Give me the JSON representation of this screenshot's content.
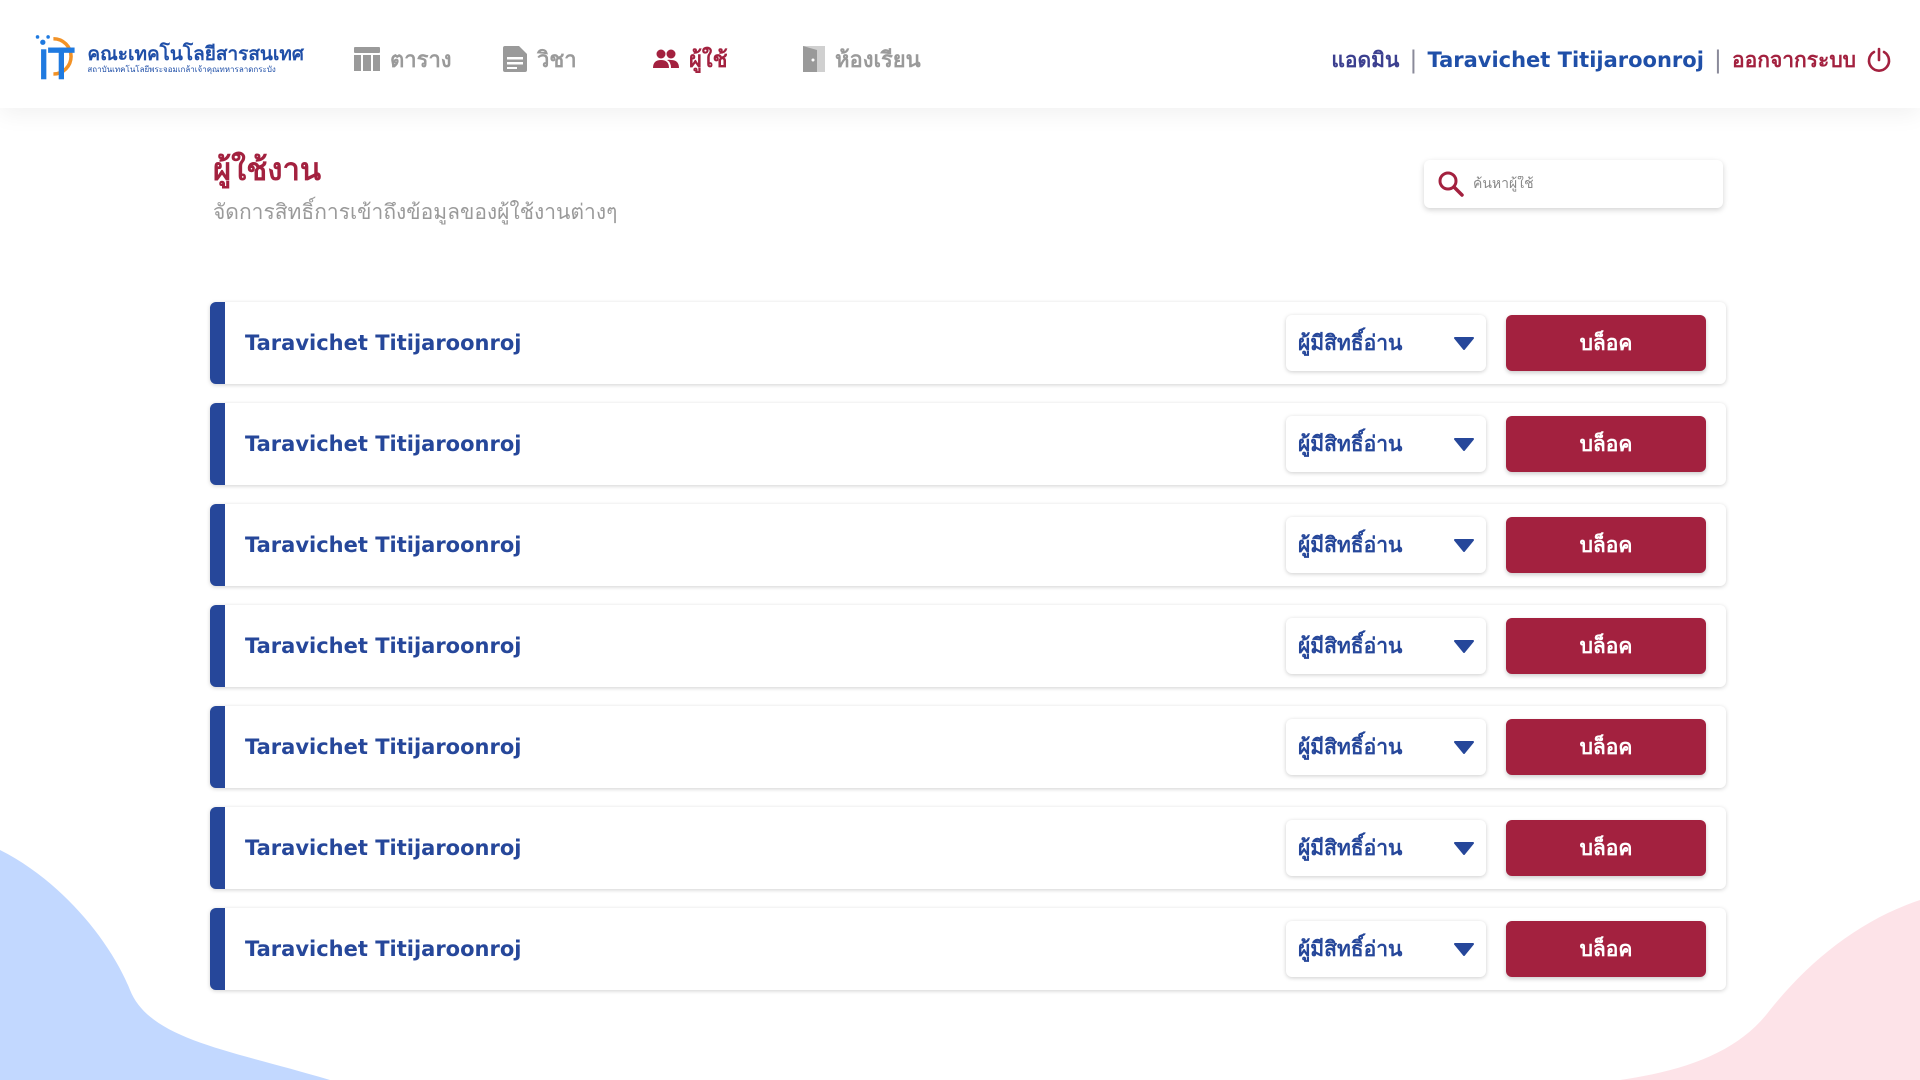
{
  "colors": {
    "brand_blue": "#1f4fa8",
    "row_accent": "#26479a",
    "primary_red": "#a3213f",
    "muted_gray": "#9a9a9a"
  },
  "header": {
    "logo": {
      "title": "คณะเทคโนโลยีสารสนเทศ",
      "subtitle": "สถาบันเทคโนโลยีพระจอมเกล้าเจ้าคุณทหารลาดกระบัง"
    },
    "nav": [
      {
        "label": "ตาราง",
        "icon": "table-icon",
        "active": false
      },
      {
        "label": "วิชา",
        "icon": "document-icon",
        "active": false
      },
      {
        "label": "ผู้ใช้",
        "icon": "users-icon",
        "active": true
      },
      {
        "label": "ห้องเรียน",
        "icon": "door-icon",
        "active": false
      }
    ],
    "user": {
      "role": "แอดมิน",
      "name": "Taravichet Titijaroonroj",
      "logout": "ออกจากระบบ",
      "logout_icon": "power-icon"
    }
  },
  "page": {
    "title": "ผู้ใช้งาน",
    "subtitle": "จัดการสิทธิ์การเข้าถึงข้อมูลของผู้ใช้งานต่างๆ"
  },
  "search": {
    "placeholder": "ค้นหาผู้ใช้",
    "value": "",
    "icon": "search-icon"
  },
  "users": [
    {
      "name": "Taravichet Titijaroonroj",
      "role": "ผู้มีสิทธิ์อ่าน",
      "action": "บล็อค"
    },
    {
      "name": "Taravichet Titijaroonroj",
      "role": "ผู้มีสิทธิ์อ่าน",
      "action": "บล็อค"
    },
    {
      "name": "Taravichet Titijaroonroj",
      "role": "ผู้มีสิทธิ์อ่าน",
      "action": "บล็อค"
    },
    {
      "name": "Taravichet Titijaroonroj",
      "role": "ผู้มีสิทธิ์อ่าน",
      "action": "บล็อค"
    },
    {
      "name": "Taravichet Titijaroonroj",
      "role": "ผู้มีสิทธิ์อ่าน",
      "action": "บล็อค"
    },
    {
      "name": "Taravichet Titijaroonroj",
      "role": "ผู้มีสิทธิ์อ่าน",
      "action": "บล็อค"
    },
    {
      "name": "Taravichet Titijaroonroj",
      "role": "ผู้มีสิทธิ์อ่าน",
      "action": "บล็อค"
    }
  ]
}
